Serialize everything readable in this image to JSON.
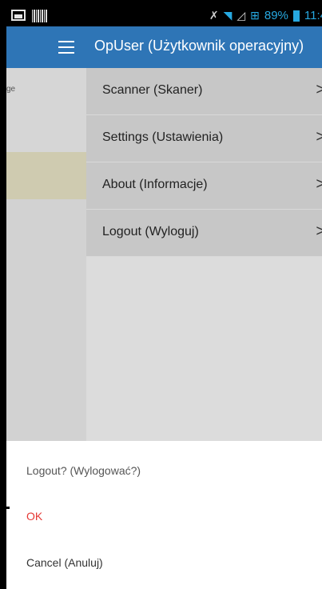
{
  "status_bar": {
    "battery": "89%",
    "time": "11:4",
    "icons": [
      "image-icon",
      "barcode-icon",
      "mute-icon",
      "wifi-icon",
      "signal-icon",
      "network-icon",
      "battery-icon"
    ]
  },
  "left_pane": {
    "partial_text": "ge"
  },
  "drawer": {
    "title": "OpUser (Użytkownik operacyjny)",
    "items": [
      {
        "label": "Scanner (Skaner)"
      },
      {
        "label": "Settings (Ustawienia)"
      },
      {
        "label": "About (Informacje)"
      },
      {
        "label": "Logout (Wyloguj)"
      }
    ],
    "chevron": ">"
  },
  "dialog": {
    "title": "Logout? (Wylogować?)",
    "ok": "OK",
    "cancel": "Cancel (Anuluj)"
  },
  "colors": {
    "header": "#2e75b6",
    "status_accent": "#27a9e1",
    "ok_text": "#e53935"
  }
}
